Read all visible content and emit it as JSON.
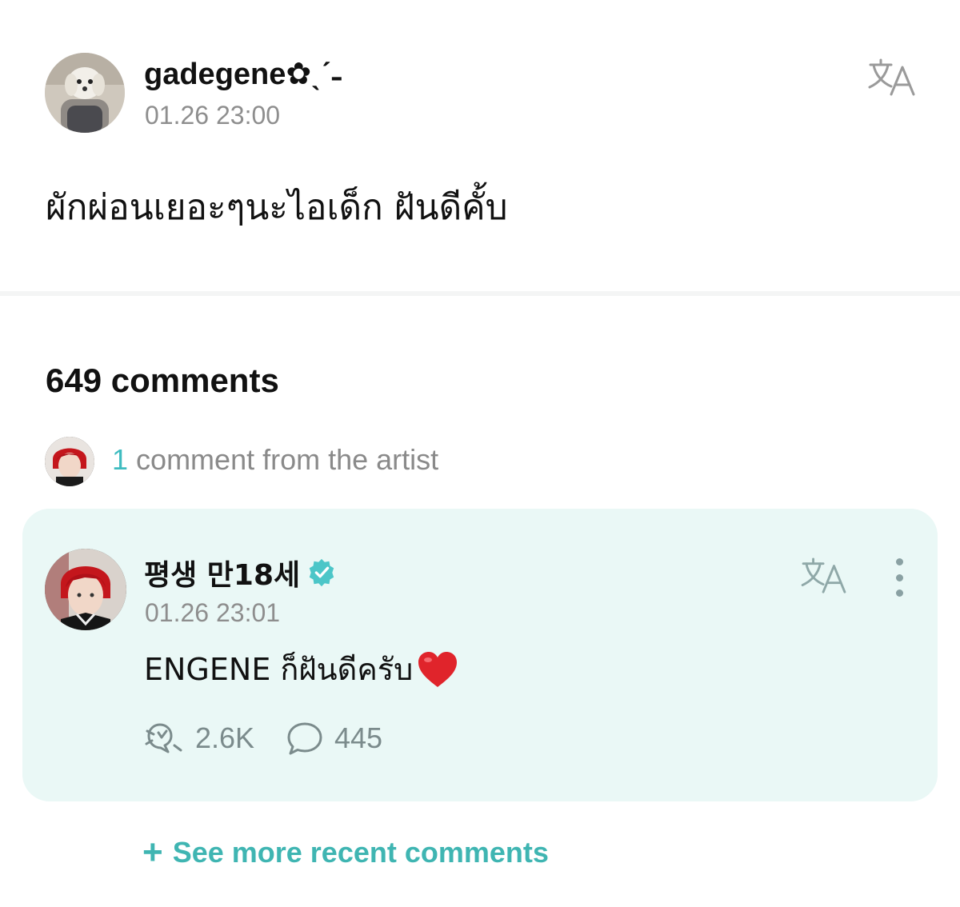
{
  "post": {
    "author": "gadegene✿ˎˊ˗",
    "time": "01.26 23:00",
    "body": "ผักผ่อนเยอะๆนะไอเด็ก ฝันดีคั้บ",
    "translate_icon": "translate-icon"
  },
  "comments": {
    "count_label": "649 comments",
    "artist_count": "1",
    "artist_label": "comment from the artist"
  },
  "artist_comment": {
    "author": "평생 만18세",
    "verified_icon": "verified-badge-icon",
    "time": "01.26 23:01",
    "body": "ENGENE ก็ฝันดีครับ",
    "likes": "2.6K",
    "replies": "445"
  },
  "see_more": {
    "label": "See more recent comments"
  },
  "colors": {
    "accent": "#3fbcc0",
    "card_bg": "#eaf8f6",
    "muted": "#8e8e8e"
  }
}
